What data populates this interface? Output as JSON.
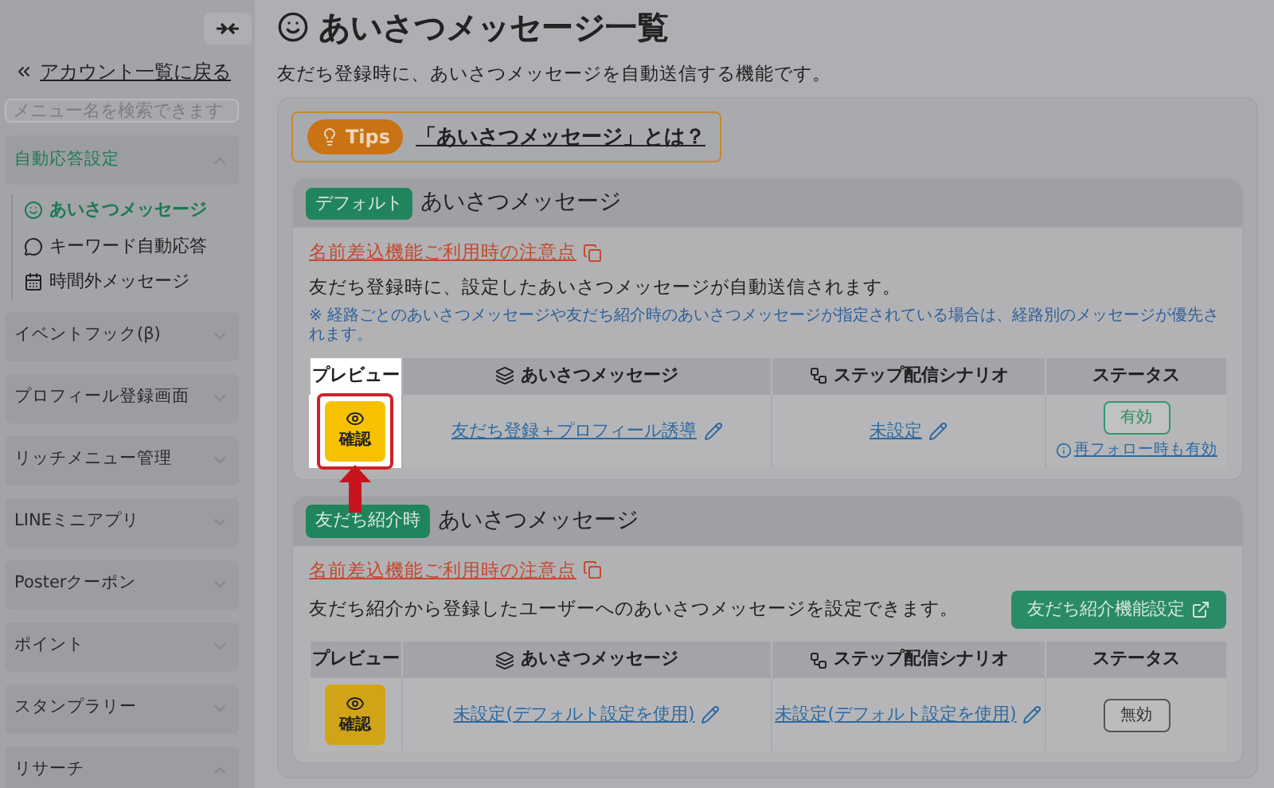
{
  "sidebar": {
    "back_link": "アカウント一覧に戻る",
    "search": {
      "placeholder": "メニュー名を検索できます"
    },
    "groups": [
      {
        "label": "自動応答設定",
        "expanded": true,
        "selected": true,
        "children": [
          {
            "label": "あいさつメッセージ",
            "kind": "smile",
            "selected": true
          },
          {
            "label": "キーワード自動応答",
            "kind": "chat",
            "selected": false
          },
          {
            "label": "時間外メッセージ",
            "kind": "calendar",
            "selected": false
          }
        ]
      },
      {
        "label": "イベントフック(β)",
        "expanded": false,
        "selected": false
      },
      {
        "label": "プロフィール登録画面",
        "expanded": false,
        "selected": false
      },
      {
        "label": "リッチメニュー管理",
        "expanded": false,
        "selected": false
      },
      {
        "label": "LINEミニアプリ",
        "expanded": false,
        "selected": false
      },
      {
        "label": "Posterクーポン",
        "expanded": false,
        "selected": false
      },
      {
        "label": "ポイント",
        "expanded": false,
        "selected": false
      },
      {
        "label": "スタンプラリー",
        "expanded": false,
        "selected": false
      },
      {
        "label": "リサーチ",
        "expanded": true,
        "selected": false
      }
    ]
  },
  "page": {
    "title": "あいさつメッセージ一覧",
    "description": "友だち登録時に、あいさつメッセージを自動送信する機能です。"
  },
  "tips": {
    "badge": "Tips",
    "link": "「あいさつメッセージ」とは？"
  },
  "sections": [
    {
      "tag": "デフォルト",
      "title": "あいさつメッセージ",
      "notice_link": "名前差込機能ご利用時の注意点",
      "description": "友だち登録時に、設定したあいさつメッセージが自動送信されます。",
      "note": "※ 経路ごとのあいさつメッセージや友だち紹介時のあいさつメッセージが指定されている場合は、経路別のメッセージが優先されます。",
      "spotlight": true,
      "columns": [
        "プレビュー",
        "あいさつメッセージ",
        "ステップ配信シナリオ",
        "ステータス"
      ],
      "rows": [
        {
          "preview": "確認",
          "message": "友だち登録＋プロフィール誘導",
          "scenario": "未設定",
          "status": {
            "label": "有効",
            "active": true
          },
          "status_note": "再フォロー時も有効"
        }
      ]
    },
    {
      "tag": "友だち紹介時",
      "title": "あいさつメッセージ",
      "notice_link": "名前差込機能ご利用時の注意点",
      "description": "友だち紹介から登録したユーザーへのあいさつメッセージを設定できます。",
      "button": "友だち紹介機能設定",
      "spotlight": false,
      "columns": [
        "プレビュー",
        "あいさつメッセージ",
        "ステップ配信シナリオ",
        "ステータス"
      ],
      "rows": [
        {
          "preview": "確認",
          "message": "未設定(デフォルト設定を使用)",
          "scenario": "未設定(デフォルト設定を使用)",
          "status": {
            "label": "無効",
            "active": false
          }
        }
      ]
    }
  ]
}
